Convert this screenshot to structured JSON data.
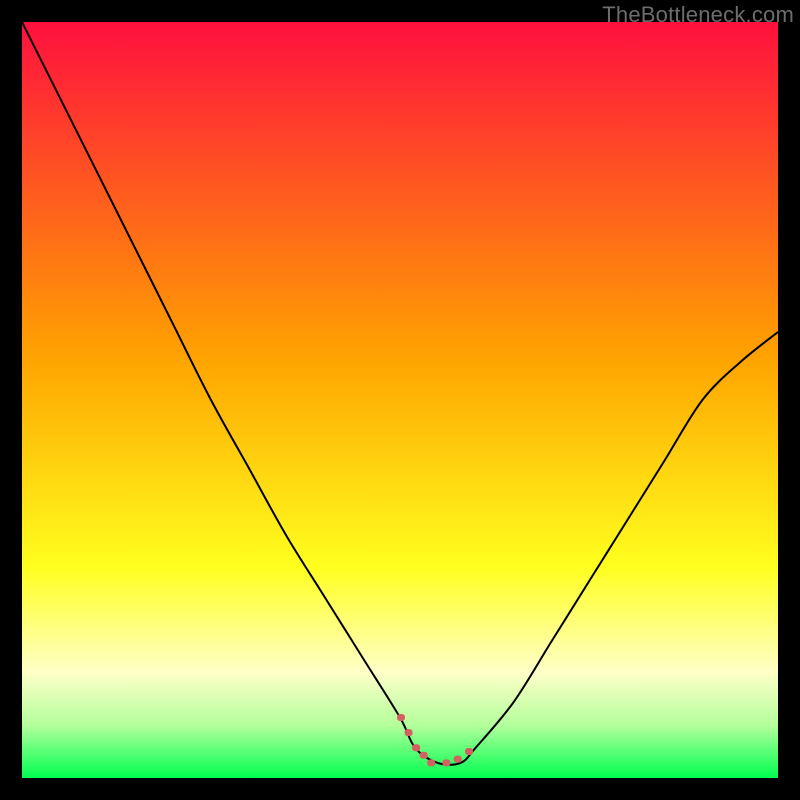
{
  "attribution": "TheBottleneck.com",
  "colors": {
    "red": "#ff103e",
    "orange": "#ffa500",
    "yellow": "#ffff1e",
    "pale_yellow": "#ffffc8",
    "light_green": "#b4ff9c",
    "green": "#00ff50",
    "curve": "#000000",
    "dotted": "#d46060",
    "frame_bg": "#000000"
  },
  "chart_data": {
    "type": "line",
    "title": "",
    "xlabel": "",
    "ylabel": "",
    "xlim": [
      0,
      100
    ],
    "ylim": [
      0,
      100
    ],
    "annotations": [],
    "series": [
      {
        "name": "bottleneck-curve",
        "x": [
          0,
          5,
          10,
          15,
          20,
          25,
          30,
          35,
          40,
          45,
          50,
          52,
          55,
          58,
          60,
          65,
          70,
          75,
          80,
          85,
          90,
          95,
          100
        ],
        "y": [
          100,
          90,
          80,
          70,
          60,
          50,
          41,
          32,
          24,
          16,
          8,
          4,
          2,
          2,
          4,
          10,
          18,
          26,
          34,
          42,
          50,
          55,
          59
        ]
      }
    ],
    "dotted_segment": {
      "name": "bottleneck-optimal-range",
      "x": [
        50,
        51,
        52,
        53,
        54,
        55,
        56,
        57,
        58,
        59,
        60
      ],
      "y": [
        8,
        6,
        4,
        3,
        2,
        2,
        2,
        2,
        3,
        3.5,
        4
      ]
    },
    "gradient_stops": [
      {
        "pos": 0.0,
        "color": "#ff103e"
      },
      {
        "pos": 0.45,
        "color": "#ffa500"
      },
      {
        "pos": 0.72,
        "color": "#ffff1e"
      },
      {
        "pos": 0.86,
        "color": "#ffffc8"
      },
      {
        "pos": 0.93,
        "color": "#b4ff9c"
      },
      {
        "pos": 1.0,
        "color": "#00ff50"
      }
    ]
  }
}
